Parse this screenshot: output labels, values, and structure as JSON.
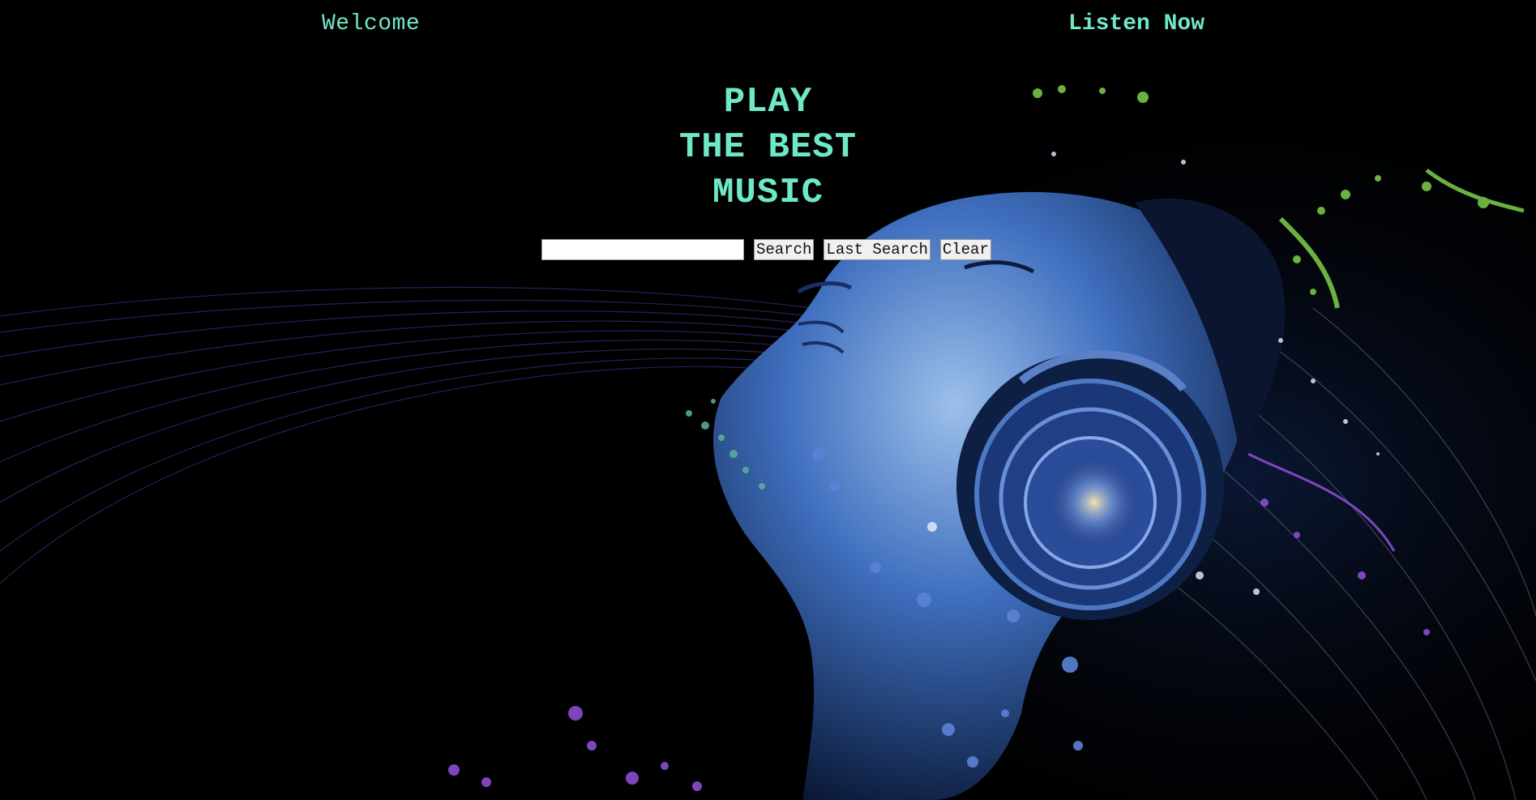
{
  "nav": {
    "welcome": "Welcome",
    "listen_now": "Listen Now"
  },
  "hero": {
    "line1": "PLAY",
    "line2": "THE BEST",
    "line3": "MUSIC"
  },
  "search": {
    "value": "",
    "placeholder": "",
    "search_label": "Search",
    "last_search_label": "Last Search",
    "clear_label": "Clear"
  },
  "colors": {
    "accent": "#6fe8c8",
    "background": "#000000"
  },
  "background_image": {
    "icon": "music-woman-headphones-artwork"
  }
}
